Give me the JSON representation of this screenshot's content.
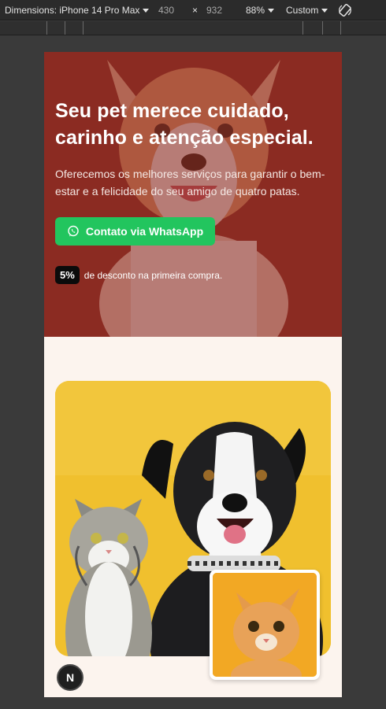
{
  "toolbar": {
    "device_label": "Dimensions: iPhone 14 Pro Max",
    "width": "430",
    "times": "×",
    "height": "932",
    "zoom": "88%",
    "throttle": "Custom"
  },
  "hero": {
    "title": "Seu pet merece cuidado, carinho e atenção especial.",
    "subtitle": "Oferecemos os melhores serviços para garantir o bem-estar e a felicidade do seu amigo de quatro patas.",
    "whatsapp_label": "Contato via WhatsApp",
    "discount_badge": "5%",
    "discount_text": "de desconto na primeira compra."
  },
  "dev_indicator": "N",
  "colors": {
    "hero_bg": "#8b2b22",
    "whatsapp": "#22c55e",
    "section_bg": "#fcf4ee",
    "photo_bg": "#f0c02e"
  },
  "icons": [
    "chevron-down-icon",
    "rotate-icon",
    "whatsapp-icon"
  ]
}
